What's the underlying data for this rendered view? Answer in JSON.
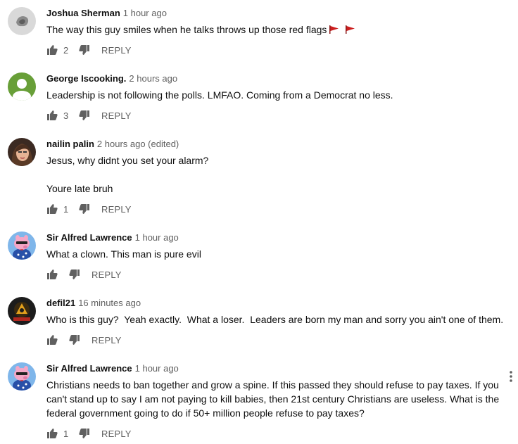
{
  "comments": [
    {
      "author": "Joshua Sherman",
      "time": "1 hour ago",
      "text": [
        "The way this guy smiles when he talks throws up those red flags"
      ],
      "likes": "2",
      "reply": "REPLY",
      "avatar": "gray-blob-avatar"
    },
    {
      "author": "George Iscooking.",
      "time": "2 hours ago",
      "text": [
        "Leadership is not following the polls. LMFAO. Coming from a Democrat no less."
      ],
      "likes": "3",
      "reply": "REPLY",
      "avatar": "default-green-avatar"
    },
    {
      "author": "nailin palin",
      "time": "2 hours ago (edited)",
      "text": [
        "Jesus, why didnt you set your alarm?",
        "Youre late bruh"
      ],
      "likes": "1",
      "reply": "REPLY",
      "avatar": "photo-avatar"
    },
    {
      "author": "Sir Alfred Lawrence",
      "time": "1 hour ago",
      "text": [
        "What a clown. This man is pure evil"
      ],
      "likes": "",
      "reply": "REPLY",
      "avatar": "cartoon-pig-avatar"
    },
    {
      "author": "defil21",
      "time": "16 minutes ago",
      "text": [
        "Who is this guy?  Yeah exactly.  What a loser.  Leaders are born my man and sorry you ain't one of them."
      ],
      "likes": "",
      "reply": "REPLY",
      "avatar": "dark-emblem-avatar"
    },
    {
      "author": "Sir Alfred Lawrence",
      "time": "1 hour ago",
      "text": [
        "Christians needs to ban together and grow a spine. If this passed they should refuse to pay taxes. If you can't stand up to say I am not paying to kill babies, then 21st century Christians are useless. What is the federal government going to do if 50+ million people refuse to pay taxes?"
      ],
      "likes": "1",
      "reply": "REPLY",
      "avatar": "cartoon-pig-avatar"
    }
  ],
  "colors": {
    "flag": "#cc1f1f",
    "icon": "#606060",
    "secondary_text": "#606060"
  }
}
